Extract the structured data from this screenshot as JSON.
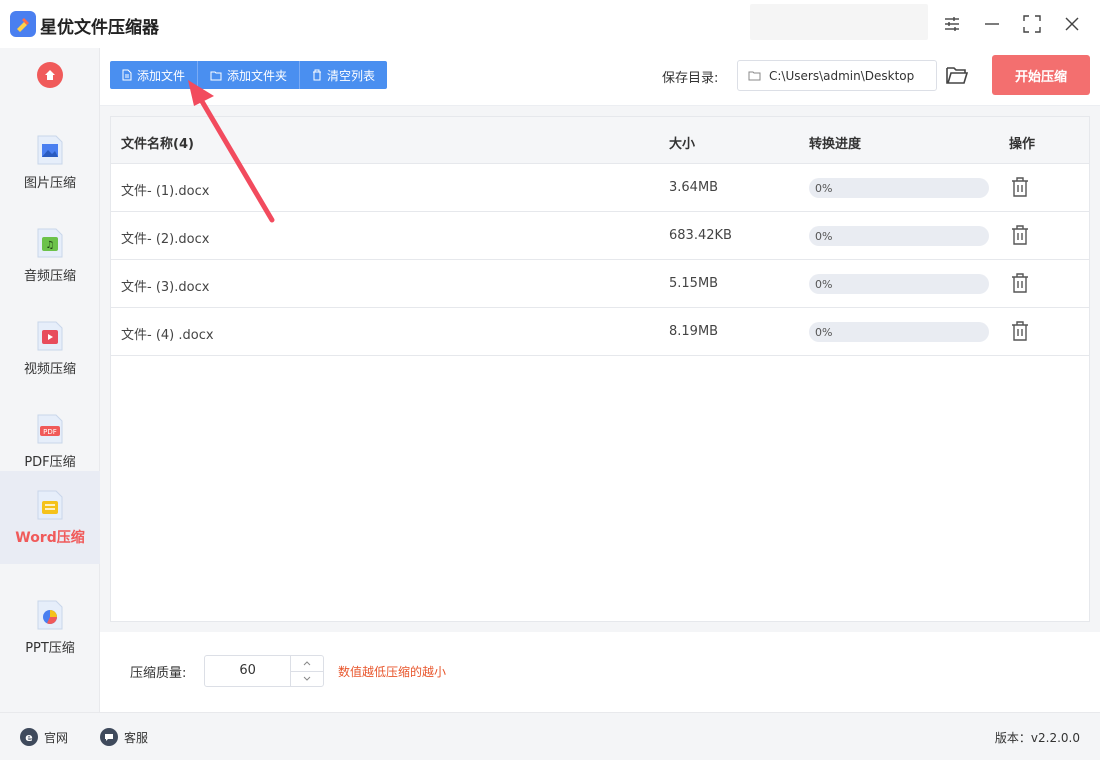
{
  "app": {
    "title": "星优文件压缩器"
  },
  "sidebar": {
    "items": [
      {
        "label": "图片压缩",
        "icon": "image-file-icon"
      },
      {
        "label": "音频压缩",
        "icon": "audio-file-icon"
      },
      {
        "label": "视频压缩",
        "icon": "video-file-icon"
      },
      {
        "label": "PDF压缩",
        "icon": "pdf-file-icon"
      },
      {
        "label": "Word压缩",
        "icon": "word-file-icon",
        "active": true
      },
      {
        "label": "PPT压缩",
        "icon": "ppt-file-icon"
      }
    ],
    "pdf_badge": "PDF"
  },
  "toolbar": {
    "add_file": "添加文件",
    "add_folder": "添加文件夹",
    "clear_list": "清空列表",
    "save_label": "保存目录:",
    "save_path": "C:\\Users\\admin\\Desktop",
    "start": "开始压缩"
  },
  "table": {
    "headers": {
      "name": "文件名称(4)",
      "size": "大小",
      "progress": "转换进度",
      "action": "操作"
    },
    "rows": [
      {
        "name": "文件- (1).docx",
        "size": "3.64MB",
        "progress": "0%"
      },
      {
        "name": "文件- (2).docx",
        "size": "683.42KB",
        "progress": "0%"
      },
      {
        "name": "文件- (3).docx",
        "size": "5.15MB",
        "progress": "0%"
      },
      {
        "name": "文件- (4) .docx",
        "size": "8.19MB",
        "progress": "0%"
      }
    ]
  },
  "quality": {
    "label": "压缩质量:",
    "value": "60",
    "hint": "数值越低压缩的越小"
  },
  "footer": {
    "website": "官网",
    "support": "客服",
    "version": "版本：v2.2.0.0"
  },
  "colors": {
    "primary": "#4a8ff0",
    "accent": "#f05a5a",
    "start_button": "#f36f6f",
    "hint": "#e8562c"
  }
}
